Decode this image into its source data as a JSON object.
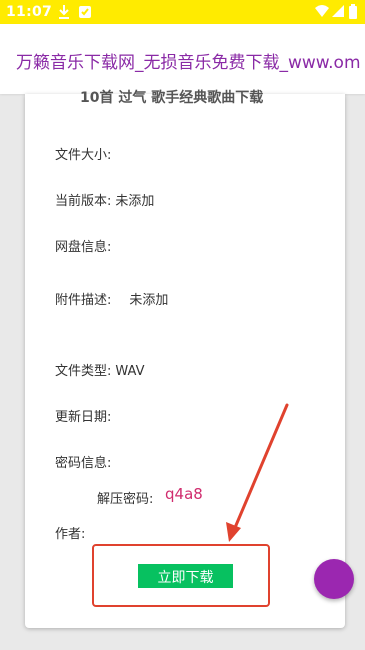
{
  "status_bar": {
    "time": "11:07",
    "background": "#ffeb00"
  },
  "header": {
    "title": "万籁音乐下载网_无损音乐免费下载_www.om",
    "title_color": "#8a2aa6"
  },
  "detail": {
    "heading": "10首 过气 歌手经典歌曲下载",
    "fields": [
      {
        "label": "文件大小:",
        "value": ""
      },
      {
        "label": "当前版本:",
        "value": "未添加"
      },
      {
        "label": "网盘信息:",
        "value": ""
      },
      {
        "label": "附件描述:",
        "value": "未添加"
      },
      {
        "label": "文件类型:",
        "value": "WAV"
      },
      {
        "label": "更新日期:",
        "value": ""
      },
      {
        "label": "密码信息:",
        "value": ""
      },
      {
        "label": "作者:",
        "value": ""
      }
    ],
    "password": {
      "label": "解压密码:",
      "value": "q4a8",
      "color": "#d02c6e"
    },
    "download_button": {
      "label": "立即下载",
      "color": "#07c160"
    }
  },
  "annotation": {
    "color": "#e0422e"
  },
  "fab": {
    "color": "#9b27b0",
    "icon": "circle-button"
  }
}
